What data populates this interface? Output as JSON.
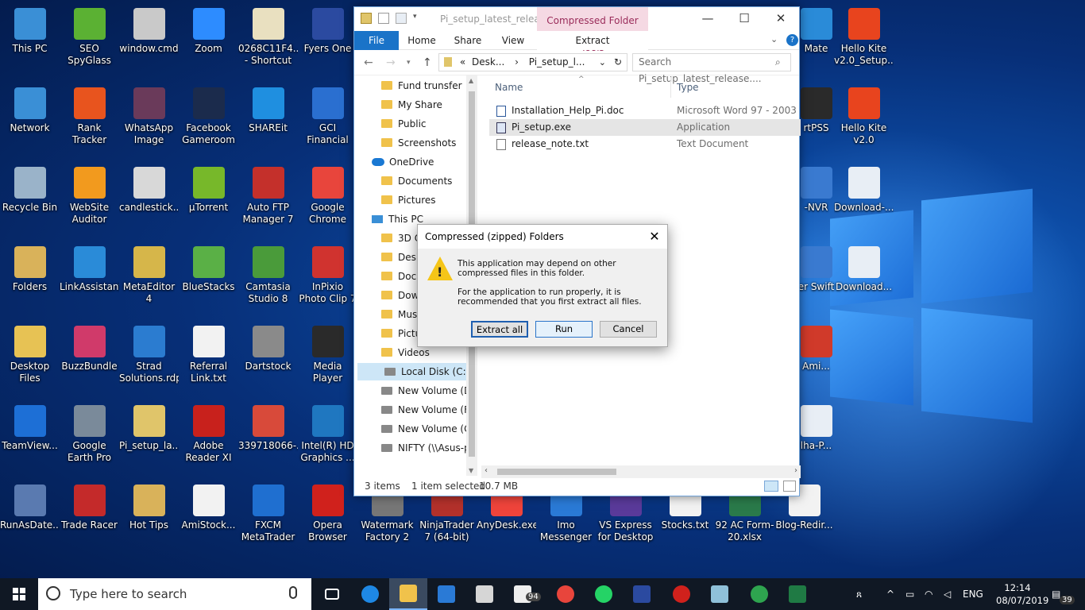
{
  "desktop": {
    "icons": [
      {
        "label": "This PC",
        "color": "#3a8fd6"
      },
      {
        "label": "SEO SpyGlass",
        "color": "#5bb133"
      },
      {
        "label": "window.cmd",
        "color": "#c9c9c9"
      },
      {
        "label": "Zoom",
        "color": "#2d8cff"
      },
      {
        "label": "0268C11F4... - Shortcut",
        "color": "#e9e0c0"
      },
      {
        "label": "Fyers One",
        "color": "#2b4aa0"
      },
      {
        "label": "Network",
        "color": "#3a8fd6"
      },
      {
        "label": "Rank Tracker",
        "color": "#e8541e"
      },
      {
        "label": "WhatsApp Image 2018...",
        "color": "#6a3a5a"
      },
      {
        "label": "Facebook Gameroom",
        "color": "#1b2b4c"
      },
      {
        "label": "SHAREit",
        "color": "#1f8fe0"
      },
      {
        "label": "GCI Financial MetaTrader 4",
        "color": "#2a6fd0"
      },
      {
        "label": "Recycle Bin",
        "color": "#9ab3c9"
      },
      {
        "label": "WebSite Auditor",
        "color": "#f29a1e"
      },
      {
        "label": "candlestick...",
        "color": "#d8d8d8"
      },
      {
        "label": "µTorrent",
        "color": "#77b82a"
      },
      {
        "label": "Auto FTP Manager 7",
        "color": "#c4302b"
      },
      {
        "label": "Google Chrome",
        "color": "#e8453c"
      },
      {
        "label": "Folders",
        "color": "#d9b25a"
      },
      {
        "label": "LinkAssistant",
        "color": "#2a8bd8"
      },
      {
        "label": "MetaEditor 4",
        "color": "#d6b64a"
      },
      {
        "label": "BlueStacks",
        "color": "#5ab046"
      },
      {
        "label": "Camtasia Studio 8",
        "color": "#4a9b3a"
      },
      {
        "label": "InPixio Photo Clip 7",
        "color": "#d0332f"
      },
      {
        "label": "Desktop Files",
        "color": "#e7c254"
      },
      {
        "label": "BuzzBundle",
        "color": "#d03a6a"
      },
      {
        "label": "Strad Solutions.rdp",
        "color": "#2b7cd0"
      },
      {
        "label": "Referral Link.txt",
        "color": "#f2f2f2"
      },
      {
        "label": "Dartstock",
        "color": "#8a8a8a"
      },
      {
        "label": "Media Player Classic",
        "color": "#2a2a2a"
      },
      {
        "label": "TeamView...",
        "color": "#1d6fd6"
      },
      {
        "label": "Google Earth Pro",
        "color": "#7a8a9a"
      },
      {
        "label": "Pi_setup_la...",
        "color": "#e0c56a"
      },
      {
        "label": "Adobe Reader XI",
        "color": "#c8211c"
      },
      {
        "label": "339718066-...",
        "color": "#d84a3a"
      },
      {
        "label": "Intel(R) HD Graphics ...",
        "color": "#1f77c0"
      },
      {
        "label": "RunAsDate...",
        "color": "#5a7ab0"
      },
      {
        "label": "Trade Racer",
        "color": "#c42a2a"
      },
      {
        "label": "Hot Tips",
        "color": "#d9b25a"
      },
      {
        "label": "AmiStock...",
        "color": "#f2f2f2"
      },
      {
        "label": "FXCM MetaTrader 4",
        "color": "#1f6fd0"
      },
      {
        "label": "Opera Browser",
        "color": "#d0211c"
      },
      {
        "label": "Watermark Factory 2",
        "color": "#777777"
      },
      {
        "label": "NinjaTrader 7 (64-bit)",
        "color": "#b3312b"
      },
      {
        "label": "AnyDesk.exe",
        "color": "#ef443b"
      },
      {
        "label": "Imo Messenger",
        "color": "#2a7ad6"
      },
      {
        "label": "VS Express for Desktop",
        "color": "#5a3a9a"
      },
      {
        "label": "Stocks.txt",
        "color": "#f2f2f2"
      },
      {
        "label": "92 AC Form-20.xlsx",
        "color": "#2a7a4a"
      },
      {
        "label": "Blog-Redir...",
        "color": "#f2f2f2"
      },
      {
        "label": "Mate",
        "color": "#2a8bd8"
      },
      {
        "label": "Hello Kite v2.0_Setup....",
        "color": "#e8441e"
      },
      {
        "label": "rtPSS",
        "color": "#2a2a2a"
      },
      {
        "label": "Hello Kite v2.0",
        "color": "#e8441e"
      },
      {
        "label": "-NVR",
        "color": "#3a7ad0"
      },
      {
        "label": "Download-...",
        "color": "#e8eef5"
      },
      {
        "label": "er Swift",
        "color": "#3a7ad0"
      },
      {
        "label": "Download...",
        "color": "#e8eef5"
      },
      {
        "label": "Ami...",
        "color": "#d03a2a"
      },
      {
        "label": "lha-P...",
        "color": "#e8eef5"
      }
    ]
  },
  "explorer": {
    "title": "Pi_setup_latest_relea...",
    "context_tab": "Compressed Folder Tools",
    "ribbon_tabs": [
      "File",
      "Home",
      "Share",
      "View"
    ],
    "context_subtab": "Extract",
    "address": {
      "prefix": "«",
      "parts": [
        "Desk...",
        "Pi_setup_l..."
      ]
    },
    "search_placeholder": "Search Pi_setup_latest_release....",
    "nav_items": [
      {
        "label": "Fund trunsfer",
        "kind": "folder"
      },
      {
        "label": "My Share",
        "kind": "folder"
      },
      {
        "label": "Public",
        "kind": "folder"
      },
      {
        "label": "Screenshots",
        "kind": "folder"
      },
      {
        "label": "OneDrive",
        "kind": "cloud"
      },
      {
        "label": "Documents",
        "kind": "folder"
      },
      {
        "label": "Pictures",
        "kind": "folder"
      },
      {
        "label": "This PC",
        "kind": "pc"
      },
      {
        "label": "3D O",
        "kind": "folder"
      },
      {
        "label": "Deskt",
        "kind": "folder"
      },
      {
        "label": "Docu",
        "kind": "folder"
      },
      {
        "label": "Down",
        "kind": "folder"
      },
      {
        "label": "Musi",
        "kind": "folder"
      },
      {
        "label": "Pictures",
        "kind": "folder"
      },
      {
        "label": "Videos",
        "kind": "folder"
      },
      {
        "label": "Local Disk (C:)",
        "kind": "drive"
      },
      {
        "label": "New Volume (D:",
        "kind": "drive"
      },
      {
        "label": "New Volume (F:)",
        "kind": "drive"
      },
      {
        "label": "New Volume (G:",
        "kind": "drive"
      },
      {
        "label": "NIFTY (\\\\Asus-p",
        "kind": "drive"
      }
    ],
    "columns": {
      "name": "Name",
      "type": "Type"
    },
    "files": [
      {
        "name": "Installation_Help_Pi.doc",
        "type": "Microsoft Word 97 - 2003 ..."
      },
      {
        "name": "Pi_setup.exe",
        "type": "Application"
      },
      {
        "name": "release_note.txt",
        "type": "Text Document"
      }
    ],
    "status": {
      "count": "3 items",
      "selected": "1 item selected",
      "size": "10.7 MB"
    }
  },
  "dialog": {
    "title": "Compressed (zipped) Folders",
    "message1": "This application may depend on other compressed files in this folder.",
    "message2": "For the application to run properly, it is recommended that you first extract all files.",
    "buttons": {
      "extract": "Extract all",
      "run": "Run",
      "cancel": "Cancel"
    }
  },
  "taskbar": {
    "search_placeholder": "Type here to search",
    "lang": "ENG",
    "time": "12:14",
    "date": "08/07/2019",
    "notification_count": "39",
    "mail_badge": "94"
  }
}
